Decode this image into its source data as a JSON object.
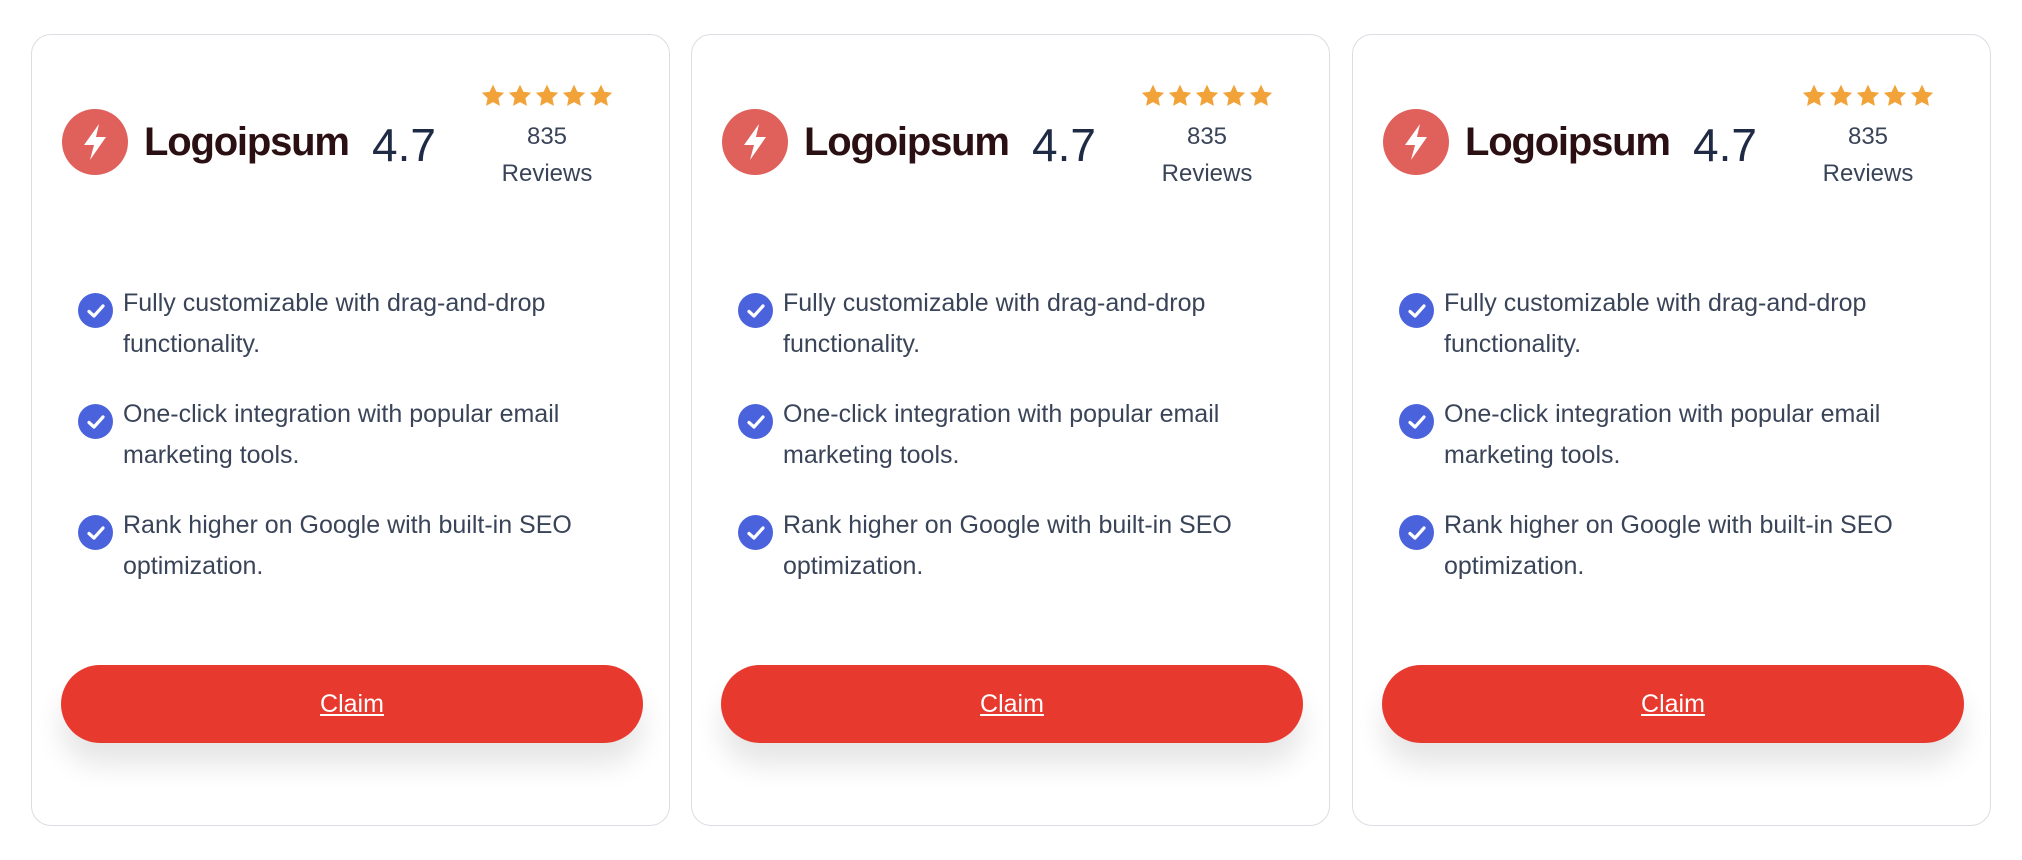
{
  "colors": {
    "brand_circle": "#e0615c",
    "brand_text": "#2a0f13",
    "star": "#f1a33a",
    "check": "#4a63dc",
    "cta": "#e8392e"
  },
  "icons": {
    "logo": "lightning-bolt-icon",
    "star": "star-icon",
    "check": "checkmark-circle-icon"
  },
  "cards": [
    {
      "brand": "Logoipsum",
      "rating": "4.7",
      "stars": 5,
      "review_count": "835",
      "review_label": "Reviews",
      "features": [
        "Fully customizable with drag-and-drop functionality.",
        "One-click integration with popular email marketing tools.",
        "Rank higher on Google with built-in SEO optimization."
      ],
      "cta_label": "Claim"
    },
    {
      "brand": "Logoipsum",
      "rating": "4.7",
      "stars": 5,
      "review_count": "835",
      "review_label": "Reviews",
      "features": [
        "Fully customizable with drag-and-drop functionality.",
        "One-click integration with popular email marketing tools.",
        "Rank higher on Google with built-in SEO optimization."
      ],
      "cta_label": "Claim"
    },
    {
      "brand": "Logoipsum",
      "rating": "4.7",
      "stars": 5,
      "review_count": "835",
      "review_label": "Reviews",
      "features": [
        "Fully customizable with drag-and-drop functionality.",
        "One-click integration with popular email marketing tools.",
        "Rank higher on Google with built-in SEO optimization."
      ],
      "cta_label": "Claim"
    }
  ]
}
